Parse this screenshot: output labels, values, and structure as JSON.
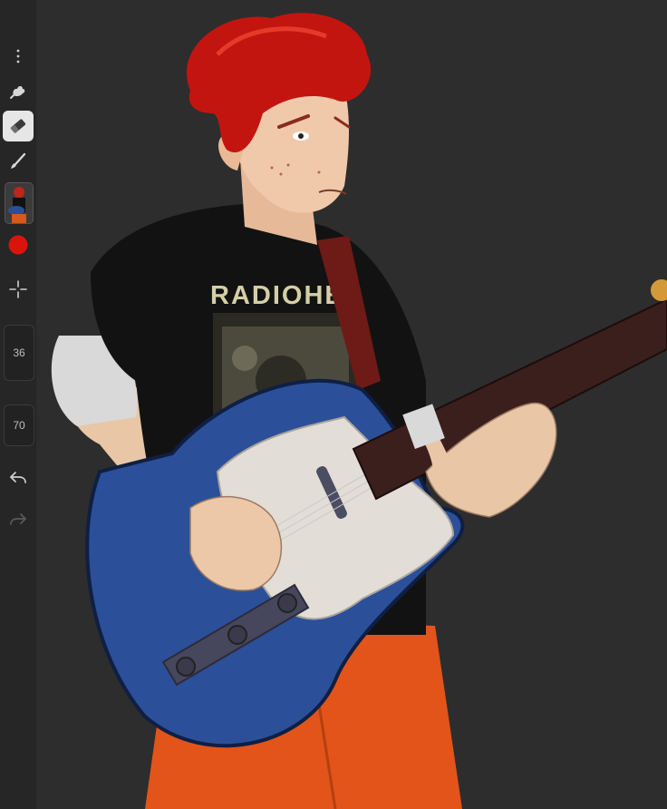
{
  "colors": {
    "toolbar_bg": "#262626",
    "canvas_bg": "#2d2d2d",
    "active_tool_bg": "#e6e6e6",
    "current_color": "#d9150b"
  },
  "toolbar": {
    "tools": [
      {
        "name": "more-options",
        "icon": "vertical-ellipsis-icon"
      },
      {
        "name": "smudge",
        "icon": "smudge-icon"
      },
      {
        "name": "eraser",
        "icon": "eraser-icon",
        "active": true
      },
      {
        "name": "brush",
        "icon": "brush-icon"
      },
      {
        "name": "layers",
        "icon": "layer-thumbnail"
      },
      {
        "name": "color",
        "icon": "color-swatch-icon"
      },
      {
        "name": "transform",
        "icon": "move-crosshair-icon"
      },
      {
        "name": "undo",
        "icon": "undo-icon"
      },
      {
        "name": "redo",
        "icon": "redo-icon",
        "disabled": true
      }
    ],
    "brush_size": "36",
    "opacity": "70"
  },
  "artwork": {
    "shirt_text": "RADIOHE",
    "subject": "guitarist-illustration"
  }
}
